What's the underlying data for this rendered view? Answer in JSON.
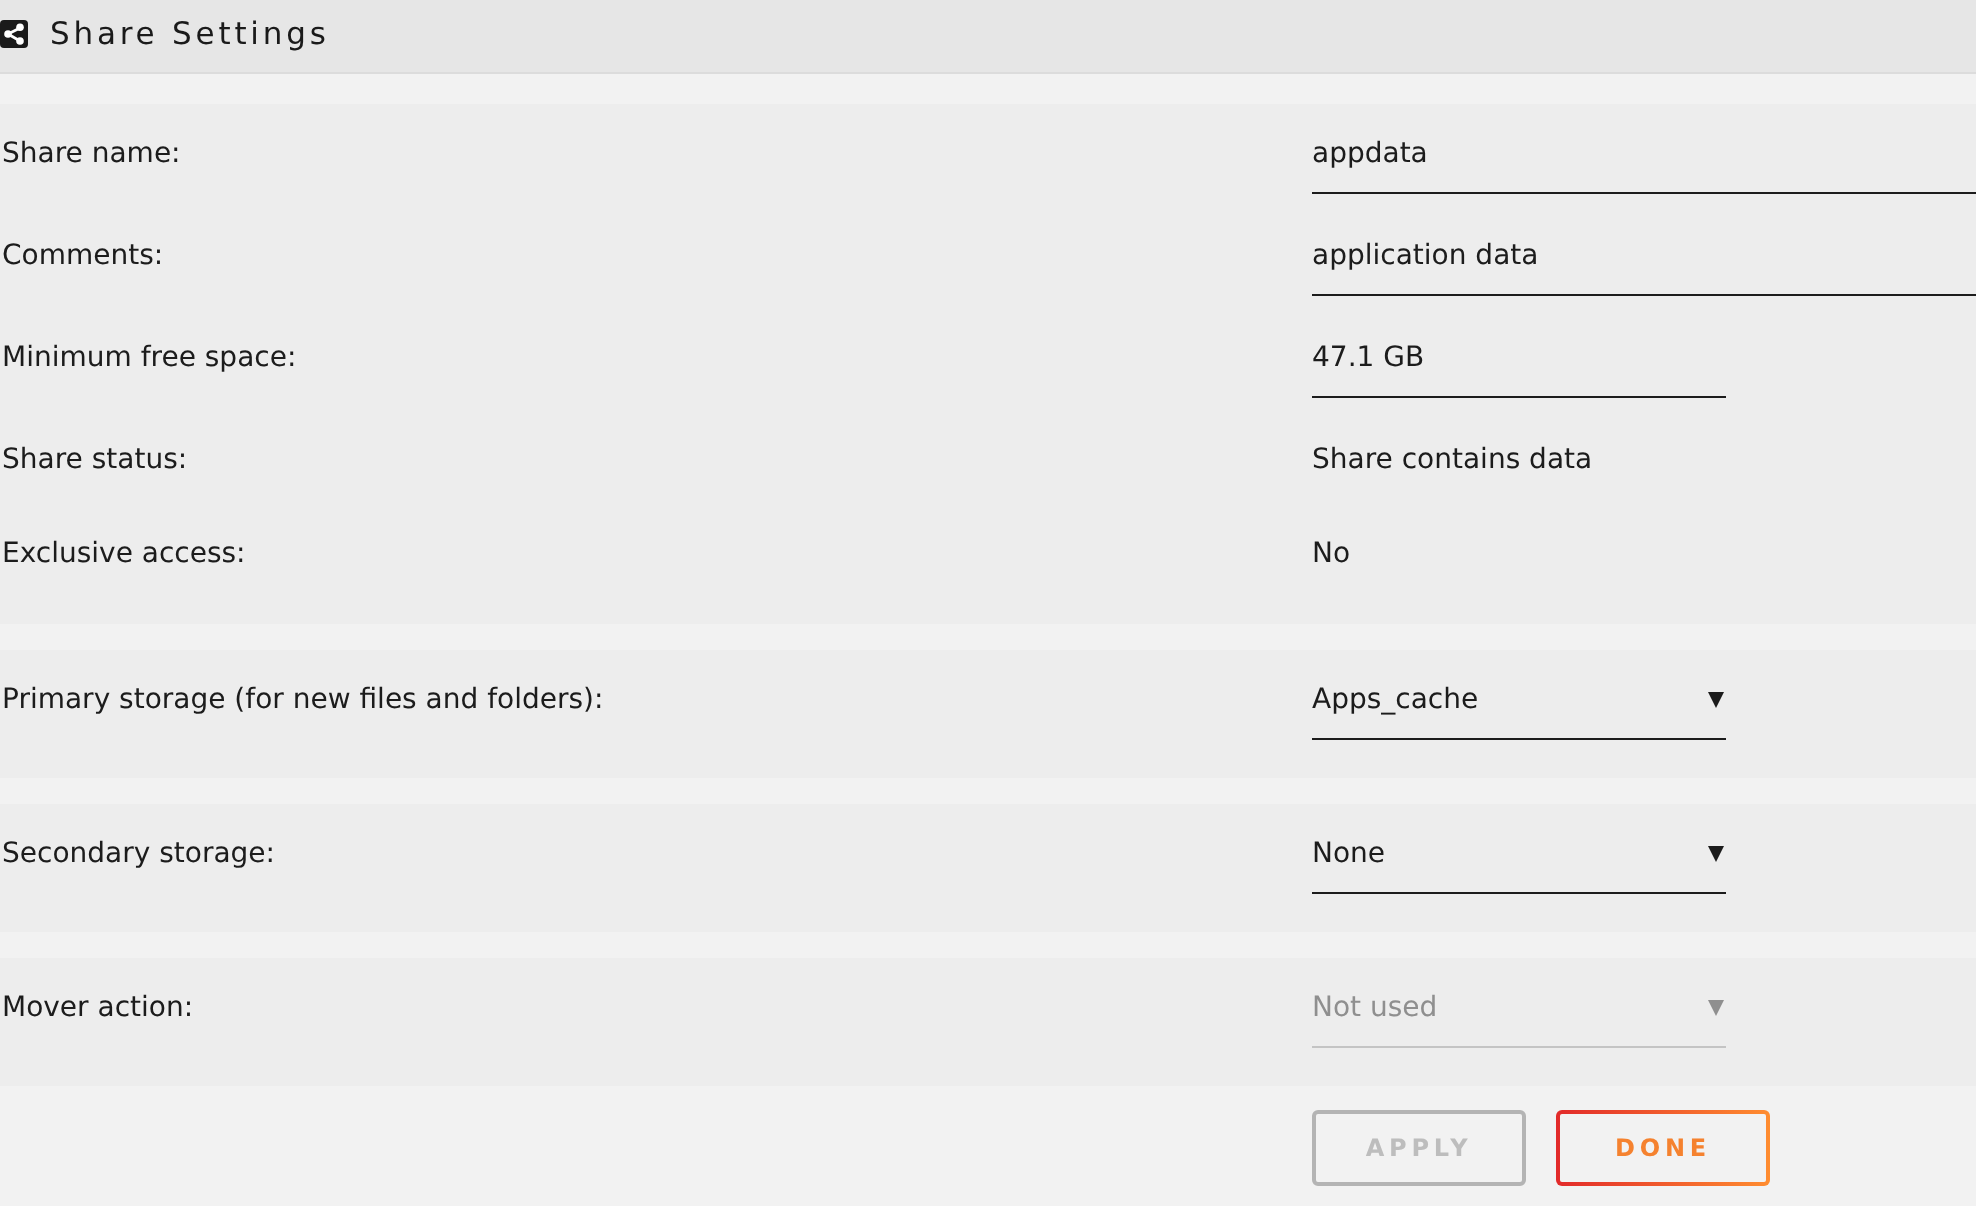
{
  "header": {
    "title": "Share Settings"
  },
  "sections": [
    {
      "rows": [
        {
          "label": "Share name:",
          "kind": "input",
          "value": "appdata"
        },
        {
          "label": "Comments:",
          "kind": "input",
          "value": "application data"
        },
        {
          "label": "Minimum free space:",
          "kind": "size",
          "value": "47.1 GB"
        },
        {
          "label": "Share status:",
          "kind": "text",
          "value": "Share contains data"
        },
        {
          "label": "Exclusive access:",
          "kind": "text",
          "value": "No"
        }
      ]
    },
    {
      "rows": [
        {
          "label": "Primary storage (for new files and folders):",
          "kind": "select",
          "value": "Apps_cache",
          "disabled": false
        }
      ]
    },
    {
      "rows": [
        {
          "label": "Secondary storage:",
          "kind": "select",
          "value": "None",
          "disabled": false
        }
      ]
    },
    {
      "rows": [
        {
          "label": "Mover action:",
          "kind": "select",
          "value": "Not used",
          "disabled": true
        }
      ]
    }
  ],
  "buttons": [
    {
      "label": "APPLY",
      "disabled": true
    },
    {
      "label": "DONE",
      "disabled": false
    }
  ]
}
